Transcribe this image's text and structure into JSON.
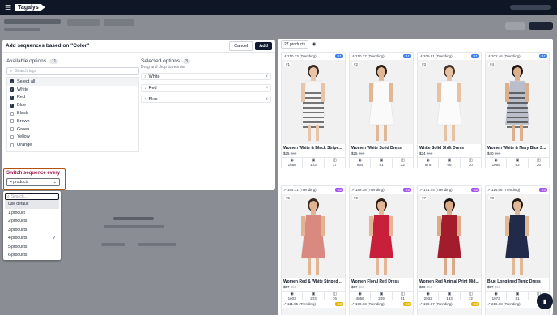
{
  "app": {
    "logo": "Tagalys"
  },
  "modal": {
    "title": "Add sequences based on \"Color\"",
    "cancel_label": "Cancel",
    "add_label": "Add",
    "available": {
      "title": "Available options",
      "count": "11",
      "search_placeholder": "Search tags",
      "select_all": "Select all",
      "options": [
        {
          "label": "White",
          "checked": true
        },
        {
          "label": "Red",
          "checked": true
        },
        {
          "label": "Blue",
          "checked": true
        },
        {
          "label": "Black",
          "checked": false
        },
        {
          "label": "Brown",
          "checked": false
        },
        {
          "label": "Green",
          "checked": false
        },
        {
          "label": "Yellow",
          "checked": false
        },
        {
          "label": "Orange",
          "checked": false
        },
        {
          "label": "Pink",
          "checked": false
        }
      ]
    },
    "selected": {
      "title": "Selected options",
      "count": "3",
      "hint": "Drag and drop to reorder",
      "items": [
        "White",
        "Red",
        "Blue"
      ]
    }
  },
  "switch": {
    "title": "Switch sequence every",
    "value": "4 products",
    "search_placeholder": "Search...",
    "options": [
      "Use default",
      "1 product",
      "2 products",
      "3 products",
      "4 products",
      "5 products",
      "6 products"
    ],
    "selected_index": 4
  },
  "products_panel": {
    "count_label": "27 products",
    "cards": [
      {
        "trend": "↗ 210.23 (Trending)",
        "rank": "B1",
        "rank_color": "#3b82f6",
        "pos": "#1",
        "name": "Women White & Black Stripe...",
        "price": "$25",
        "mrp": "$55",
        "views": "1668",
        "a": "103",
        "b": "37",
        "dress": "#f4f4f4",
        "stripe": true,
        "skin": "#e8c4a8",
        "hair": "#3a2a20"
      },
      {
        "trend": "↗ 210.27 (Trending)",
        "rank": "B1",
        "rank_color": "#3b82f6",
        "pos": "#2",
        "name": "Women White Solid Dress",
        "price": "$25",
        "mrp": "$55",
        "views": "964",
        "a": "81",
        "b": "22",
        "dress": "#fafafa",
        "stripe": false,
        "skin": "#e0b896",
        "hair": "#2a1e18"
      },
      {
        "trend": "↗ 209.91 (Trending)",
        "rank": "B1",
        "rank_color": "#3b82f6",
        "pos": "#3",
        "name": "White Solid Shift Dress",
        "price": "$34",
        "mrp": "$66",
        "views": "976",
        "a": "69",
        "b": "30",
        "dress": "#fbfbfb",
        "stripe": false,
        "skin": "#e6c2a4",
        "hair": "#4a3428"
      },
      {
        "trend": "↗ 202.46 (Trending)",
        "rank": "B1",
        "rank_color": "#3b82f6",
        "pos": "#4",
        "name": "Women White & Navy Blue S...",
        "price": "$40",
        "mrp": "$56",
        "views": "1059",
        "a": "63",
        "b": "26",
        "dress": "#b9bec8",
        "stripe": true,
        "skin": "#dcb08c",
        "hair": "#1e1612"
      },
      {
        "trend": "↗ 164.71 (Trending)",
        "rank": "S2",
        "rank_color": "#a855f7",
        "pos": "#5",
        "name": "Women Red & White Striped ...",
        "price": "$57",
        "mrp": "$56",
        "views": "1603",
        "a": "203",
        "b": "76",
        "dress": "#d9897f",
        "stripe": false,
        "skin": "#e2b492",
        "hair": "#3a2a22"
      },
      {
        "trend": "↗ 188.38 (Trending)",
        "rank": "S2",
        "rank_color": "#a855f7",
        "pos": "#6",
        "name": "Women Floral Red Dress",
        "price": "$57",
        "mrp": "$56",
        "views": "4056",
        "a": "209",
        "b": "91",
        "dress": "#c8203a",
        "stripe": false,
        "skin": "#e4b696",
        "hair": "#2c1e16"
      },
      {
        "trend": "↗ 171.44 (Trending)",
        "rank": "S2",
        "rank_color": "#a855f7",
        "pos": "#7",
        "name": "Women Red Animal Print Mid...",
        "price": "$50",
        "mrp": "$55",
        "views": "2932",
        "a": "183",
        "b": "72",
        "dress": "#a31c2c",
        "stripe": false,
        "skin": "#d9ab88",
        "hair": "#1a1210"
      },
      {
        "trend": "↗ 114.66 (Trending)",
        "rank": "S2",
        "rank_color": "#a855f7",
        "pos": "#8",
        "name": "Blue Longlined Tunic Dress",
        "price": "$57",
        "mrp": "$56",
        "views": "1073",
        "a": "81",
        "b": "21",
        "dress": "#222a4a",
        "stripe": false,
        "skin": "#e0b896",
        "hair": "#241a14"
      }
    ],
    "bottom_row": [
      {
        "trend": "↗ 111.05 (Trending)",
        "rank": "S3"
      },
      {
        "trend": "↗ 190.63 (Trending)",
        "rank": "S3"
      },
      {
        "trend": "↗ 190.87 (Trending)",
        "rank": "S3"
      },
      {
        "trend": "↗ 216.18 (Trending)",
        "rank": "S3"
      }
    ]
  },
  "colors": {
    "brand": "#0f1727",
    "accent": "#111a2e",
    "switch_border": "#b45309"
  }
}
